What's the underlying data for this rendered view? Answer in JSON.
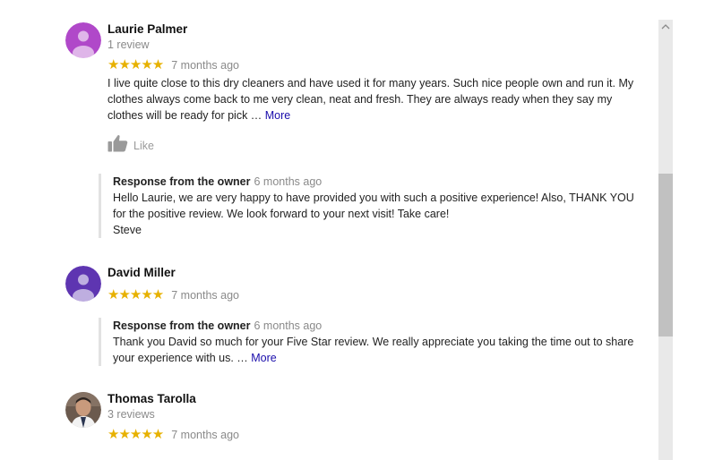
{
  "reviews": [
    {
      "name": "Laurie Palmer",
      "meta": "1 review",
      "rating": 5,
      "stars": "★★★★★",
      "date": "7 months ago",
      "avatar": "avatar-person-icon",
      "avatar_color": "#b048c9",
      "text": "I live quite close to this dry cleaners and have used it for many years.  Such nice people own and run it. My clothes always come back to me very clean, neat and fresh.  They are always ready when they say my clothes will be ready for pick … ",
      "more": "More",
      "like": "Like",
      "response": {
        "title": "Response from the owner",
        "date": "6 months ago",
        "text": "Hello Laurie, we are very happy to have provided you with such a positive experience! Also, THANK YOU for the positive review. We look forward to your next visit! Take care!\nSteve"
      }
    },
    {
      "name": "David Miller",
      "rating": 5,
      "stars": "★★★★★",
      "date": "7 months ago",
      "avatar": "avatar-person-icon",
      "avatar_color": "#5e35b1",
      "response": {
        "title": "Response from the owner",
        "date": "6 months ago",
        "text": "Thank you David so much for your Five Star review. We really appreciate you taking the time out to share your experience with us. … ",
        "more": "More"
      }
    },
    {
      "name": "Thomas Tarolla",
      "meta": "3 reviews",
      "rating": 5,
      "stars": "★★★★★",
      "date": "7 months ago",
      "avatar": "avatar-photo"
    }
  ],
  "colors": {
    "star": "#e7b100",
    "link": "#1a0dab",
    "muted": "#8a8a8a"
  },
  "scrollbar": {
    "up_icon": "chevron-up-icon"
  }
}
